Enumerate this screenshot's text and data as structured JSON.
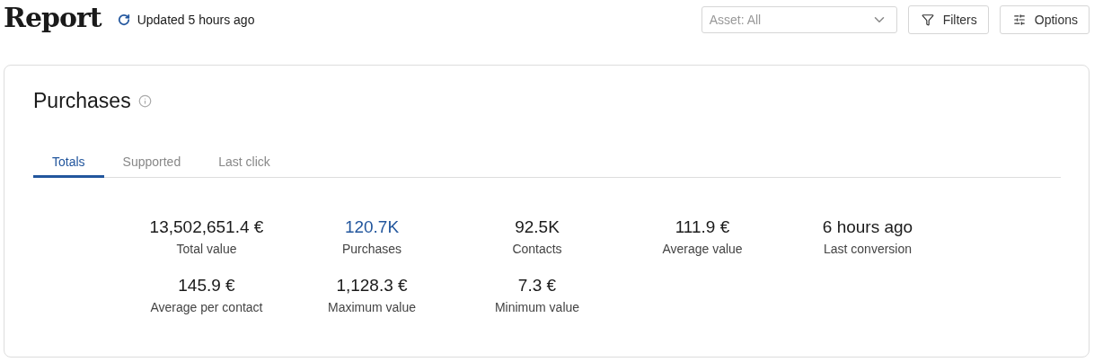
{
  "header": {
    "title": "Report",
    "updated": "Updated 5 hours ago",
    "asset_select": {
      "placeholder": "Asset: All"
    },
    "buttons": [
      "Filters",
      "Options"
    ]
  },
  "card": {
    "title": "Purchases",
    "tabs": [
      {
        "label": "Totals",
        "selected": true
      },
      {
        "label": "Supported",
        "selected": false
      },
      {
        "label": "Last click",
        "selected": false
      }
    ],
    "metrics": [
      {
        "value": "13,502,651.4 €",
        "label": "Total value",
        "highlighted": false
      },
      {
        "value": "120.7K",
        "label": "Purchases",
        "highlighted": true
      },
      {
        "value": "92.5K",
        "label": "Contacts",
        "highlighted": false
      },
      {
        "value": "111.9 €",
        "label": "Average value",
        "highlighted": false
      },
      {
        "value": "6 hours ago",
        "label": "Last conversion",
        "highlighted": false
      },
      {
        "value": "145.9 €",
        "label": "Average per contact",
        "highlighted": false
      },
      {
        "value": "1,128.3 €",
        "label": "Maximum value",
        "highlighted": false
      },
      {
        "value": "7.3 €",
        "label": "Minimum value",
        "highlighted": false
      }
    ]
  }
}
